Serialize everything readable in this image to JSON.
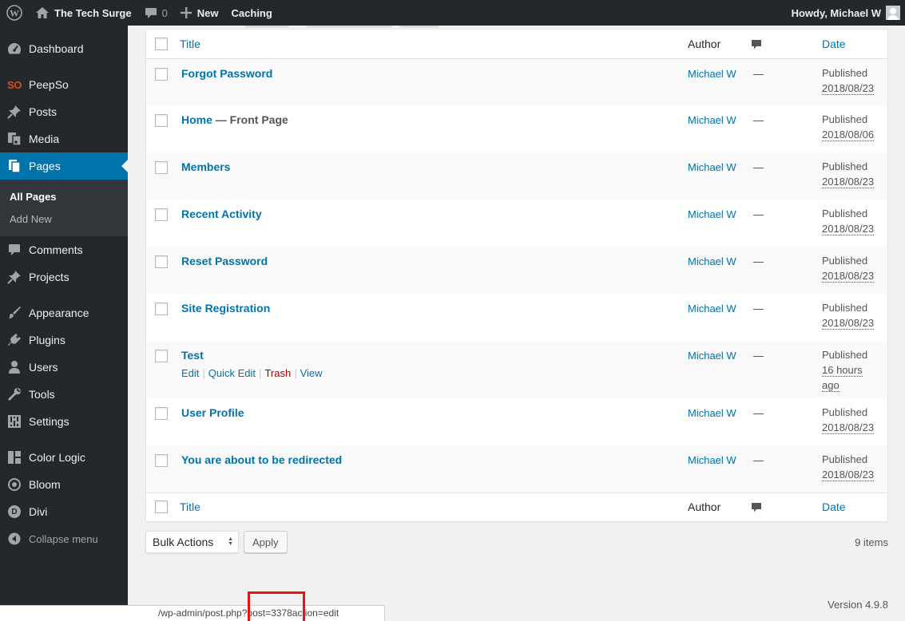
{
  "adminbar": {
    "site_name": "The Tech Surge",
    "comments_count": "0",
    "new_label": "New",
    "caching_label": "Caching",
    "howdy": "Howdy, Michael W"
  },
  "sidebar": {
    "items": [
      {
        "label": "Dashboard",
        "icon": "dashboard-icon"
      },
      {
        "label": "PeepSo",
        "icon": "peepso-logo-icon",
        "icon_text": "SO"
      },
      {
        "label": "Posts",
        "icon": "pushpin-icon"
      },
      {
        "label": "Media",
        "icon": "media-icon"
      },
      {
        "label": "Pages",
        "icon": "pages-icon",
        "current": true
      },
      {
        "label": "Comments",
        "icon": "comment-icon"
      },
      {
        "label": "Projects",
        "icon": "pushpin-icon"
      },
      {
        "label": "Appearance",
        "icon": "paintbrush-icon"
      },
      {
        "label": "Plugins",
        "icon": "plugin-icon"
      },
      {
        "label": "Users",
        "icon": "users-icon"
      },
      {
        "label": "Tools",
        "icon": "wrench-icon"
      },
      {
        "label": "Settings",
        "icon": "settings-icon"
      },
      {
        "label": "Color Logic",
        "icon": "grid-icon"
      },
      {
        "label": "Bloom",
        "icon": "bloom-icon"
      },
      {
        "label": "Divi",
        "icon": "divi-icon",
        "icon_text": "D"
      }
    ],
    "submenu": [
      "All Pages",
      "Add New"
    ],
    "collapse_label": "Collapse menu"
  },
  "table": {
    "columns": {
      "title": "Title",
      "author": "Author",
      "date": "Date"
    },
    "rows": [
      {
        "title": "Forgot Password",
        "state": "",
        "author": "Michael W",
        "comments": "—",
        "status": "Published",
        "date": "2018/08/23"
      },
      {
        "title": "Home",
        "state": " — Front Page",
        "author": "Michael W",
        "comments": "—",
        "status": "Published",
        "date": "2018/08/06"
      },
      {
        "title": "Members",
        "state": "",
        "author": "Michael W",
        "comments": "—",
        "status": "Published",
        "date": "2018/08/23"
      },
      {
        "title": "Recent Activity",
        "state": "",
        "author": "Michael W",
        "comments": "—",
        "status": "Published",
        "date": "2018/08/23"
      },
      {
        "title": "Reset Password",
        "state": "",
        "author": "Michael W",
        "comments": "—",
        "status": "Published",
        "date": "2018/08/23"
      },
      {
        "title": "Site Registration",
        "state": "",
        "author": "Michael W",
        "comments": "—",
        "status": "Published",
        "date": "2018/08/23"
      },
      {
        "title": "Test",
        "state": "",
        "author": "Michael W",
        "comments": "—",
        "status": "Published",
        "date_line1": "16 hours",
        "date_line2": "ago"
      },
      {
        "title": "User Profile",
        "state": "",
        "author": "Michael W",
        "comments": "—",
        "status": "Published",
        "date": "2018/08/23"
      },
      {
        "title": "You are about to be redirected",
        "state": "",
        "author": "Michael W",
        "comments": "—",
        "status": "Published",
        "date": "2018/08/23"
      }
    ],
    "row_actions": {
      "edit": "Edit",
      "quick_edit": "Quick Edit",
      "trash": "Trash",
      "view": "View"
    }
  },
  "tablenav": {
    "bulk_actions": "Bulk Actions",
    "apply": "Apply",
    "items_count": "9 items"
  },
  "footer": {
    "version": "Version 4.9.8"
  },
  "status_bar": {
    "url": "/wp-admin/post.php?post=3378action=edit"
  },
  "colors": {
    "accent": "#0073aa",
    "sidebar_bg": "#23282d",
    "trash": "#aa0000",
    "highlight": "#ee1111"
  }
}
